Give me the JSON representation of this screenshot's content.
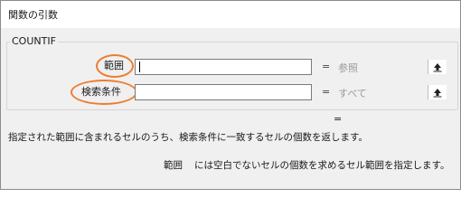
{
  "dialog": {
    "title": "関数の引数"
  },
  "function_group": {
    "name": "COUNTIF"
  },
  "arguments": [
    {
      "label": "範囲",
      "value": "",
      "hint": "参照"
    },
    {
      "label": "検索条件",
      "value": "",
      "hint": "すべて"
    }
  ],
  "equals": "=",
  "result": {
    "equals": "=",
    "value": ""
  },
  "description": "指定された範囲に含まれるセルのうち、検索条件に一致するセルの個数を返します。",
  "arg_description": {
    "name": "範囲",
    "text": "には空白でないセルの個数を求めるセル範囲を指定します。"
  },
  "icons": {
    "collapse": "collapse-dialog-icon"
  },
  "colors": {
    "highlight_ring": "#ed7d31"
  }
}
